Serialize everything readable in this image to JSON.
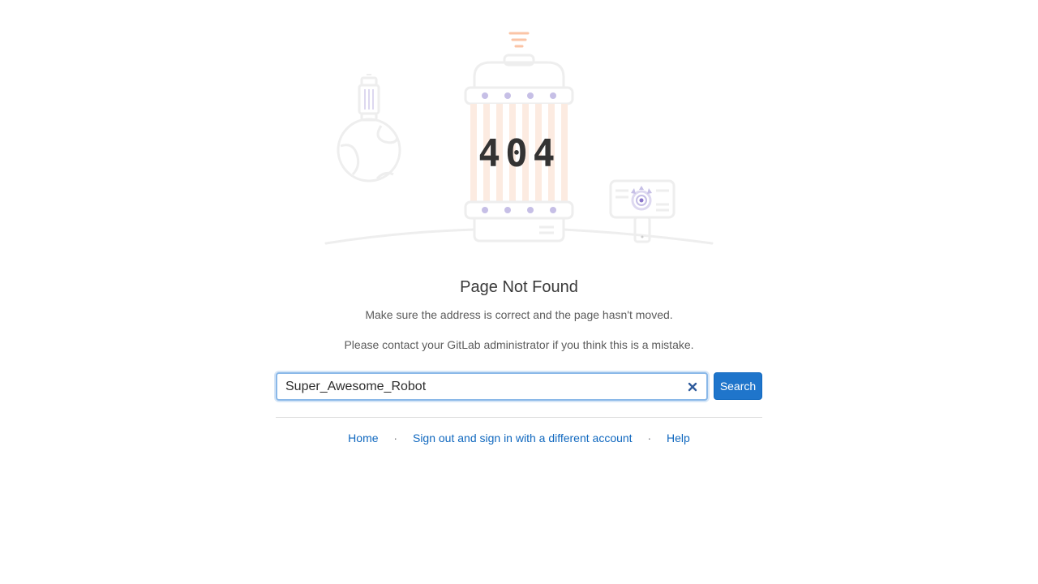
{
  "illustration": {
    "code_text": "404",
    "colors": {
      "outline": "#eeeeee",
      "dots": "#c6bfe6",
      "stripes": "#fcebe1",
      "beacon": "#fbc4a6",
      "eye": "#8a75c9"
    }
  },
  "heading": "Page Not Found",
  "description_1": "Make sure the address is correct and the page hasn't moved.",
  "description_2": "Please contact your GitLab administrator if you think this is a mistake.",
  "search": {
    "value": "Super_Awesome_Robot",
    "button_label": "Search",
    "clear_icon": "close-icon"
  },
  "footer": {
    "links": [
      {
        "label": "Home"
      },
      {
        "label": "Sign out and sign in with a different account"
      },
      {
        "label": "Help"
      }
    ],
    "separator": "·"
  },
  "colors": {
    "primary": "#1f75cb",
    "link": "#1068bf",
    "focus_border": "#8ab8e8"
  }
}
